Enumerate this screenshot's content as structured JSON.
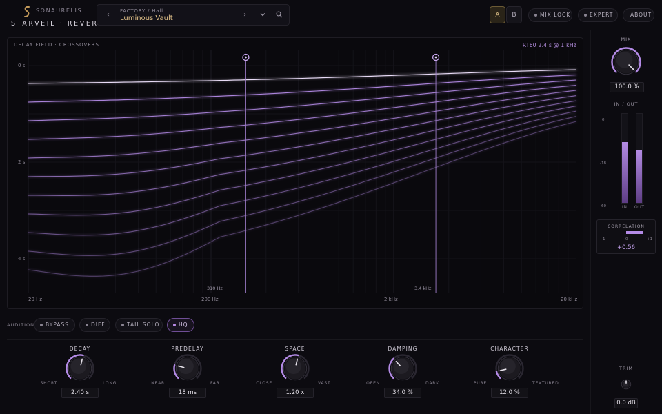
{
  "header": {
    "brand": "SONAURELIS",
    "product": "STARVEIL · REVERB",
    "preset": {
      "bank": "FACTORY / Hall",
      "name": "Luminous Vault",
      "prev_glyph": "‹",
      "next_glyph": "›",
      "dropdown_icon": "chevron-down-icon",
      "search_icon": "search-icon"
    },
    "ab": {
      "a": "A",
      "b": "B",
      "selected": "A"
    },
    "buttons": {
      "mix_lock": "MIX LOCK",
      "expert": "EXPERT",
      "about": "ABOUT"
    }
  },
  "graph": {
    "title": "DECAY FIELD · CROSSOVERS",
    "rt60": "RT60 2.4 s @ 1 kHz",
    "y_labels": [
      "0 s",
      "2 s",
      "4 s"
    ],
    "x_labels": [
      "20 Hz",
      "200 Hz",
      "2 kHz",
      "20 kHz"
    ],
    "crossovers": [
      {
        "label": "310 Hz",
        "hz": 310
      },
      {
        "label": "3.4 kHz",
        "hz": 3400
      }
    ],
    "curve_count": 11,
    "colors": {
      "curve": "#b48be6",
      "accent": "#e4c68c"
    }
  },
  "audition": {
    "label": "AUDITION",
    "buttons": [
      {
        "label": "BYPASS",
        "active": false
      },
      {
        "label": "DIFF",
        "active": false
      },
      {
        "label": "TAIL SOLO",
        "active": false
      },
      {
        "label": "HQ",
        "active": true
      }
    ]
  },
  "knobs": [
    {
      "title": "DECAY",
      "min": "SHORT",
      "max": "LONG",
      "value": "2.40 s",
      "norm": 0.55
    },
    {
      "title": "PREDELAY",
      "min": "NEAR",
      "max": "FAR",
      "value": "18 ms",
      "norm": 0.22
    },
    {
      "title": "SPACE",
      "min": "CLOSE",
      "max": "VAST",
      "value": "1.20 x",
      "norm": 0.55
    },
    {
      "title": "DAMPING",
      "min": "OPEN",
      "max": "DARK",
      "value": "34.0 %",
      "norm": 0.34
    },
    {
      "title": "CHARACTER",
      "min": "PURE",
      "max": "TEXTURED",
      "value": "12.0 %",
      "norm": 0.12
    }
  ],
  "mix": {
    "title": "MIX",
    "value": "100.0 %",
    "norm": 1.0
  },
  "io": {
    "title": "IN  /  OUT",
    "scale": [
      "0",
      "-18",
      "-60"
    ],
    "in_label": "IN",
    "out_label": "OUT",
    "in_level": 0.68,
    "out_level": 0.59
  },
  "correlation": {
    "title": "CORRELATION",
    "min": "-1",
    "mid": "0",
    "max": "+1",
    "value": "+0.56"
  },
  "trim": {
    "title": "TRIM",
    "value": "0.0 dB",
    "norm": 0.5
  }
}
